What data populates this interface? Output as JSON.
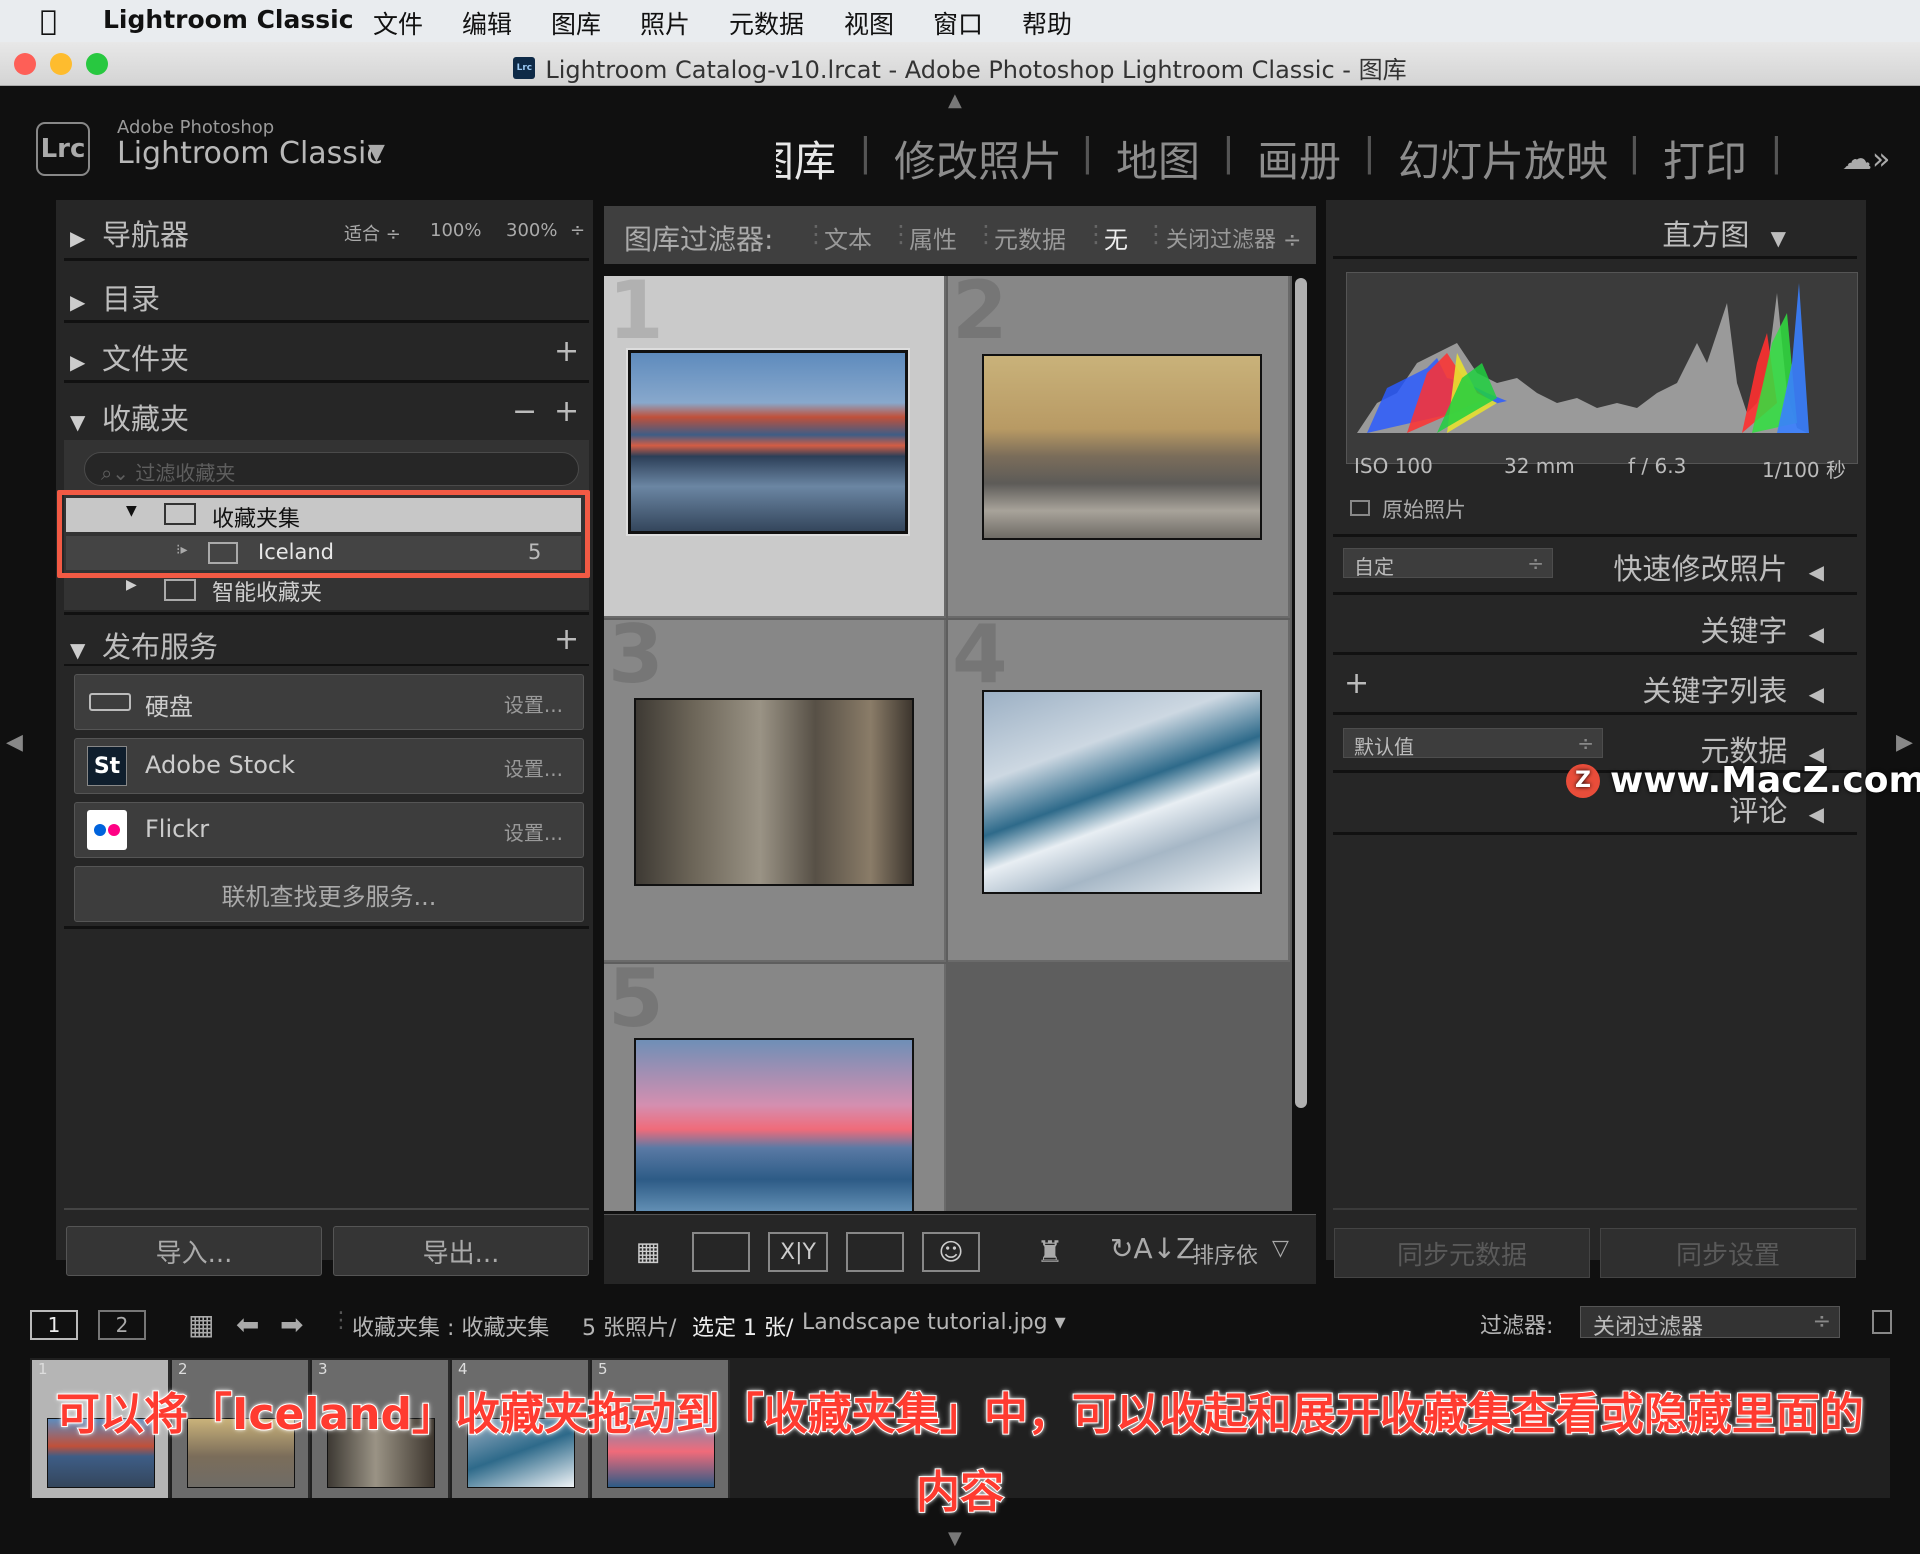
{
  "menubar": {
    "app_name": "Lightroom Classic",
    "items": [
      "文件",
      "编辑",
      "图库",
      "照片",
      "元数据",
      "视图",
      "窗口",
      "帮助"
    ]
  },
  "window": {
    "title": "Lightroom Catalog-v10.lrcat - Adobe Photoshop Lightroom Classic - 图库"
  },
  "header": {
    "brand_small": "Adobe Photoshop",
    "brand_big": "Lightroom Classic",
    "modules": [
      "图库",
      "修改照片",
      "地图",
      "画册",
      "幻灯片放映",
      "打印"
    ],
    "active_module": "图库"
  },
  "left_panel": {
    "navigator": {
      "title": "导航器",
      "zoom_fit": "适合 ÷",
      "zoom_100": "100%",
      "zoom_300": "300%"
    },
    "catalog": {
      "title": "目录"
    },
    "folders": {
      "title": "文件夹"
    },
    "collections": {
      "title": "收藏夹",
      "search_placeholder": "过滤收藏夹",
      "set_name": "收藏夹集",
      "child_name": "Iceland",
      "child_count": "5",
      "smart_name": "智能收藏夹"
    },
    "publish": {
      "title": "发布服务",
      "services": [
        {
          "name": "硬盘",
          "setup": "设置..."
        },
        {
          "name": "Adobe Stock",
          "setup": "设置..."
        },
        {
          "name": "Flickr",
          "setup": "设置..."
        }
      ],
      "find_more": "联机查找更多服务..."
    },
    "import_label": "导入...",
    "export_label": "导出..."
  },
  "filter_bar": {
    "label": "图库过滤器:",
    "text": "文本",
    "attribute": "属性",
    "metadata": "元数据",
    "none": "无",
    "off": "关闭过滤器 ÷"
  },
  "grid": {
    "cells": [
      "1",
      "2",
      "3",
      "4",
      "5"
    ]
  },
  "toolbar": {
    "sort_label": "排序依"
  },
  "right_panel": {
    "histogram": {
      "title": "直方图",
      "iso": "ISO 100",
      "focal": "32 mm",
      "aperture": "f / 6.3",
      "shutter": "1/100 秒",
      "original": "原始照片"
    },
    "quick_develop": {
      "title": "快速修改照片",
      "preset": "自定"
    },
    "keywords": {
      "title": "关键字"
    },
    "keyword_list": {
      "title": "关键字列表"
    },
    "metadata": {
      "title": "元数据",
      "preset": "默认值"
    },
    "comments": {
      "title": "评论"
    },
    "sync_metadata": "同步元数据",
    "sync_settings": "同步设置"
  },
  "filmstrip": {
    "screen1": "1",
    "screen2": "2",
    "source": "收藏夹集 : 收藏夹集",
    "count": "5 张照片/",
    "selected": "选定 1 张/",
    "filename": "Landscape tutorial.jpg ▾",
    "filter_label": "过滤器:",
    "filter_value": "关闭过滤器",
    "thumbs": [
      "1",
      "2",
      "3",
      "4",
      "5"
    ]
  },
  "watermark": {
    "icon": "Z",
    "text": "www.MacZ.com"
  },
  "caption": {
    "line1": "可以将「Iceland」收藏夹拖动到「收藏夹集」中，可以收起和展开收藏集查看或隐藏里面的",
    "line2": "内容"
  },
  "colors": {
    "accent_red": "#f25a44",
    "caption_red": "#ff3b30"
  }
}
